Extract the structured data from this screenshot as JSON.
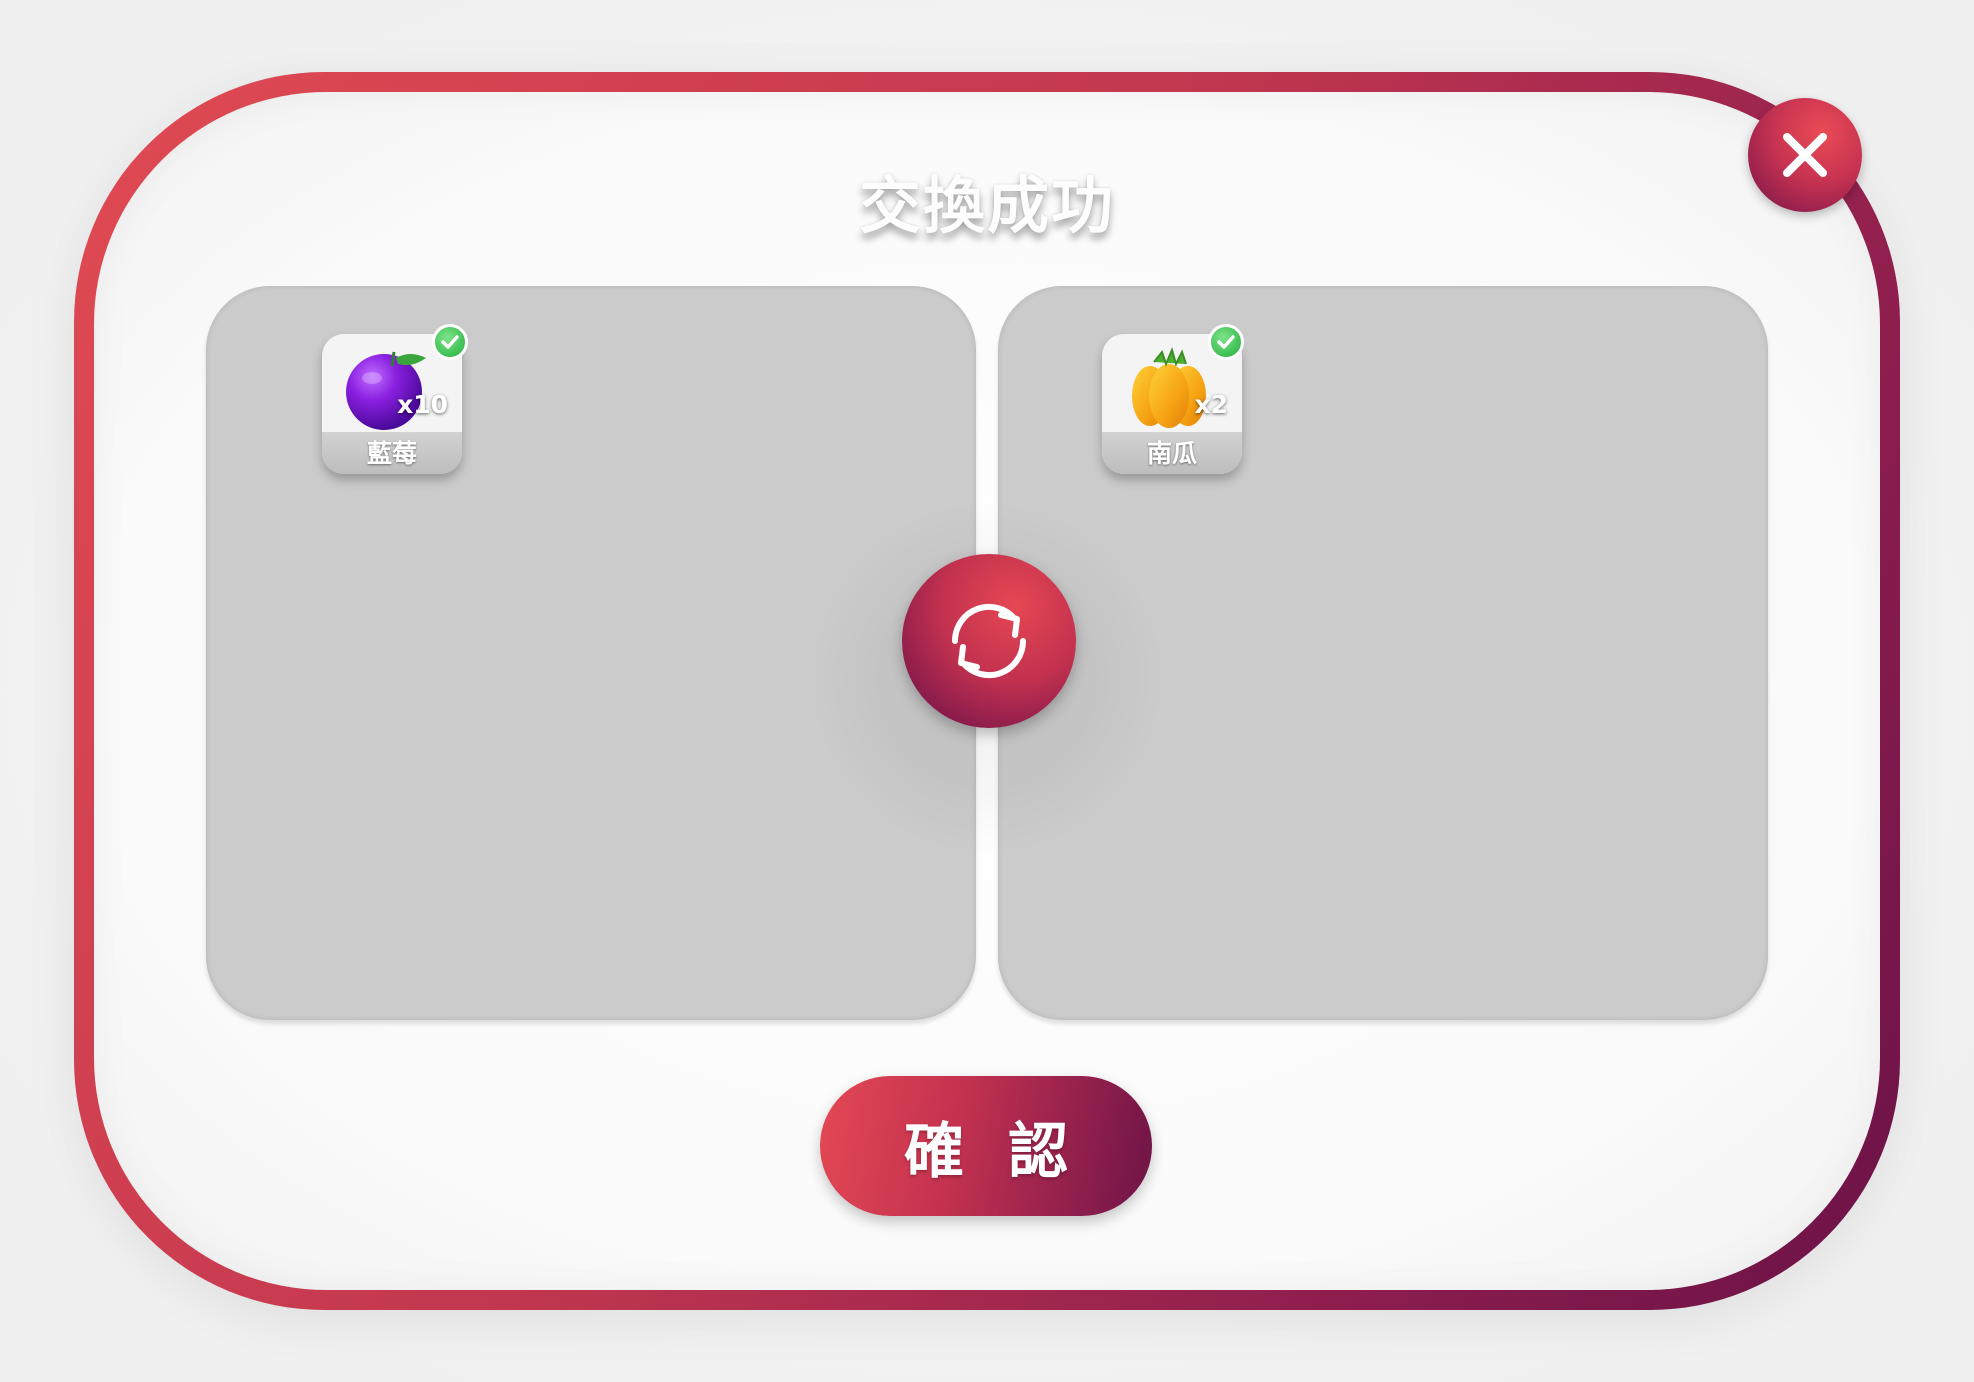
{
  "dialog": {
    "title": "交換成功",
    "close_icon": "close-icon"
  },
  "trade": {
    "left": {
      "item_name": "藍莓",
      "quantity": "x10",
      "icon": "blueberry-icon",
      "confirmed": true
    },
    "right": {
      "item_name": "南瓜",
      "quantity": "x2",
      "icon": "pumpkin-icon",
      "confirmed": true
    },
    "swap_icon": "swap-arrows-icon"
  },
  "actions": {
    "confirm_label": "確認"
  },
  "colors": {
    "accent_start": "#e04a52",
    "accent_end": "#6a1247",
    "panel_bg": "#cbcbcb",
    "check_green": "#3cbf52"
  }
}
